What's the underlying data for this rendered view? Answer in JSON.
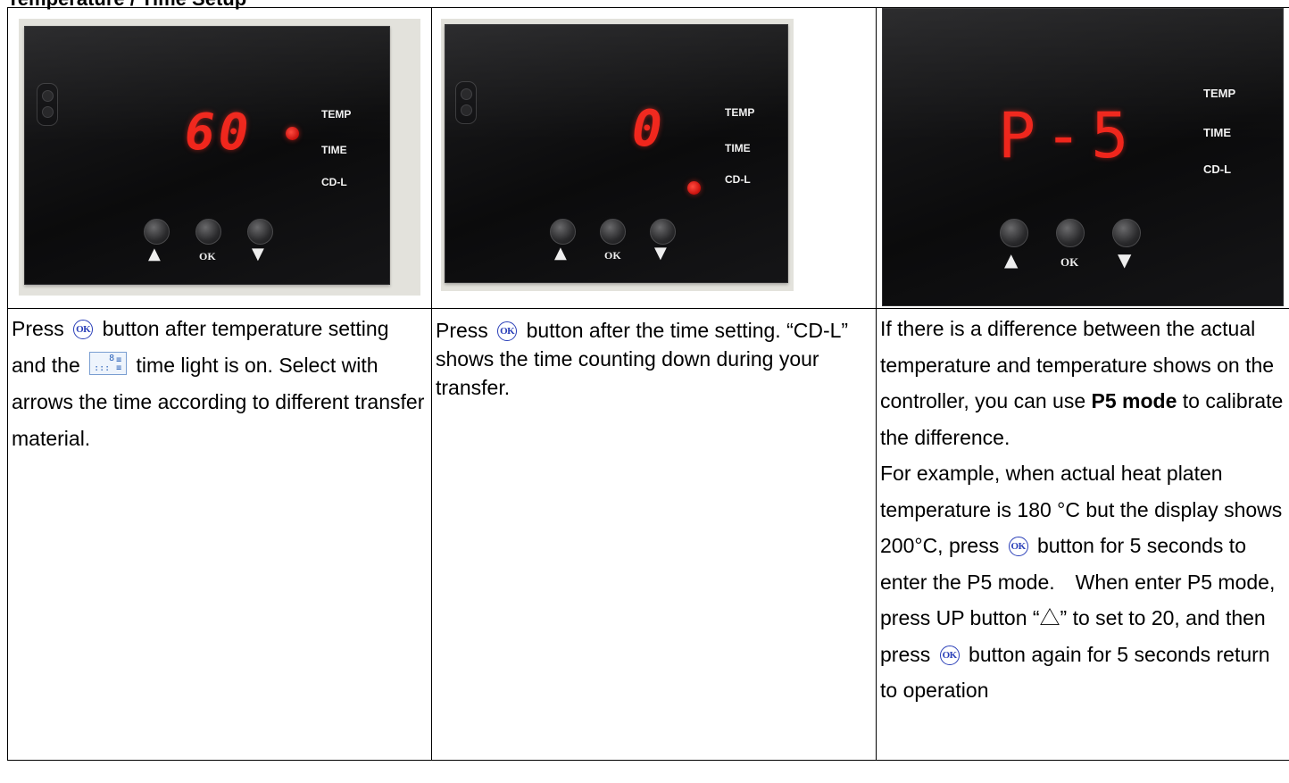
{
  "heading": "Temperature / Time Setup",
  "panels": [
    {
      "display": "60",
      "labels": [
        "TEMP",
        "TIME",
        "CD-L"
      ],
      "buttons": {
        "up": "▲",
        "ok": "OK",
        "down": "▼"
      }
    },
    {
      "display": "0",
      "labels": [
        "TEMP",
        "TIME",
        "CD-L"
      ],
      "buttons": {
        "up": "▲",
        "ok": "OK",
        "down": "▼"
      }
    },
    {
      "display": "P-5",
      "labels": [
        "TEMP",
        "TIME",
        "CD-L"
      ],
      "buttons": {
        "up": "▲",
        "ok": "OK",
        "down": "▼"
      }
    }
  ],
  "col1": {
    "press": "Press",
    "ok_icon": "OK",
    "part1": "button after temperature setting and the",
    "part2": "time light is on. Select with arrows the time according to different transfer material."
  },
  "col2": {
    "press": "Press",
    "ok_icon": "OK",
    "part1": "button after the time setting. “CD-L” shows the time counting down during your transfer."
  },
  "col3": {
    "p1a": "If there is a difference between the actual temperature and temperature shows on the controller, you can use",
    "p1b": "P5 mode",
    "p1c": "to calibrate the difference.",
    "p2a": "For example, when actual heat platen temperature is 180 °C but the display shows 200°C, press",
    "p2b": "button for 5 seconds to enter the P5 mode.　When enter P5 mode, press UP button “△” to set to 20, and then press",
    "p2c": "button again for 5 seconds return to operation",
    "ok_icon": "OK"
  }
}
